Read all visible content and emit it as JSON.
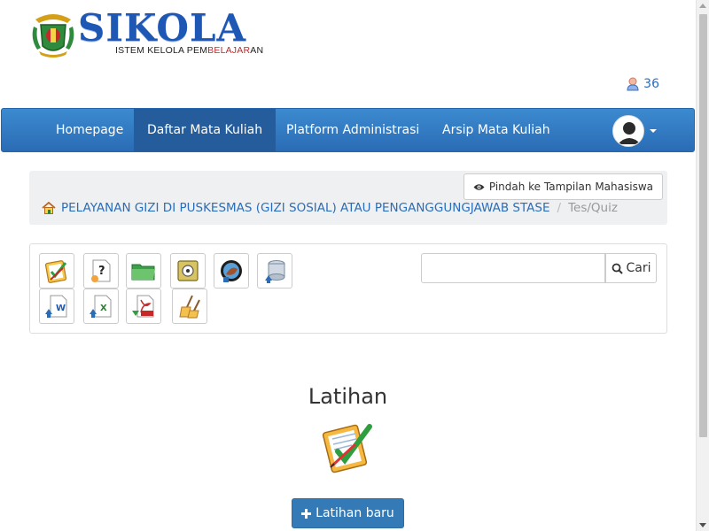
{
  "brand": {
    "title": "SIKOLA",
    "sub_prefix": "ISTEM KELOLA PEM",
    "sub_highlight": "BELAJAR",
    "sub_suffix": "AN"
  },
  "online_users": {
    "count": "36",
    "icon": "user-icon"
  },
  "navbar": {
    "items": [
      {
        "label": "Homepage",
        "active": false
      },
      {
        "label": "Daftar Mata Kuliah",
        "active": true
      },
      {
        "label": "Platform Administrasi",
        "active": false
      },
      {
        "label": "Arsip Mata Kuliah",
        "active": false
      }
    ],
    "profile_icon": "avatar"
  },
  "breadcrumb": {
    "switch_label": "Pindah ke Tampilan Mahasiswa",
    "course": "PELAYANAN GIZI DI PUSKESMAS (GIZI SOSIAL) ATAU PENGANGGUNGJAWAB STASE",
    "separator": "/",
    "current": "Tes/Quiz"
  },
  "toolbar": {
    "tools_row1": [
      "quiz-icon",
      "question-icon",
      "folder-icon",
      "safe-icon",
      "backup-icon",
      "database-upload-icon"
    ],
    "tools_row2": [
      "word-upload-icon",
      "excel-upload-icon",
      "pdf-download-icon",
      "clean-icon"
    ],
    "search_placeholder": "",
    "search_label": "Cari"
  },
  "main": {
    "title": "Latihan",
    "new_button": "Latihan baru"
  },
  "colors": {
    "navbar": "#2a6cb5",
    "navbar_active": "#245c9c",
    "link": "#2a6ebb",
    "primary_button": "#337ab7"
  }
}
